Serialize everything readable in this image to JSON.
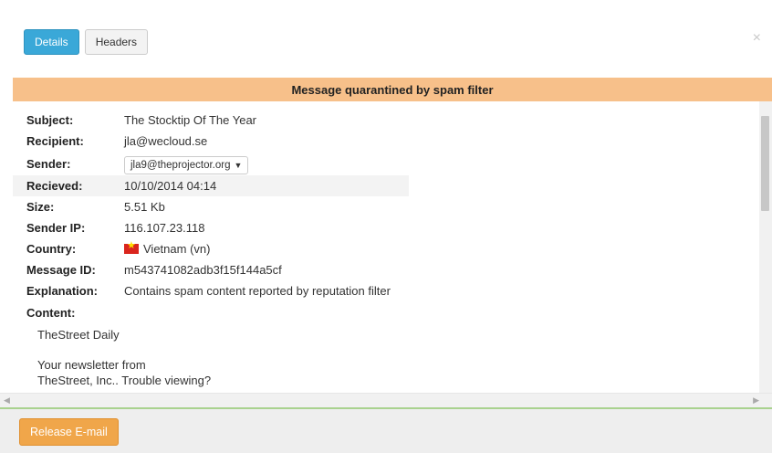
{
  "window": {
    "close_icon": "close-icon"
  },
  "tabs": [
    {
      "label": "Details",
      "active": true
    },
    {
      "label": "Headers",
      "active": false
    }
  ],
  "banner": {
    "text": "Message quarantined by spam filter",
    "color": "#f7c08a"
  },
  "fields": {
    "subject": {
      "label": "Subject:",
      "value": "The Stocktip Of The Year"
    },
    "recipient": {
      "label": "Recipient:",
      "value": "jla@wecloud.se"
    },
    "sender": {
      "label": "Sender:",
      "value": "jla9@theprojector.org"
    },
    "received": {
      "label": "Recieved:",
      "value": "10/10/2014 04:14"
    },
    "size": {
      "label": "Size:",
      "value": "5.51 Kb"
    },
    "sender_ip": {
      "label": "Sender IP:",
      "value": "116.107.23.118"
    },
    "country": {
      "label": "Country:",
      "value": "Vietnam (vn)",
      "flag": "vietnam-flag-icon"
    },
    "message_id": {
      "label": "Message ID:",
      "value": "m543741082adb3f15f144a5cf"
    },
    "explanation": {
      "label": "Explanation:",
      "value": "Contains spam content reported by reputation filter"
    },
    "content": {
      "label": "Content:"
    }
  },
  "email_body": {
    "line1": "TheStreet Daily",
    "line2": "Your newsletter from",
    "line3": "TheStreet, Inc.. Trouble viewing?"
  },
  "footer": {
    "release_label": "Release E-mail",
    "accent": "#f0a64a"
  }
}
